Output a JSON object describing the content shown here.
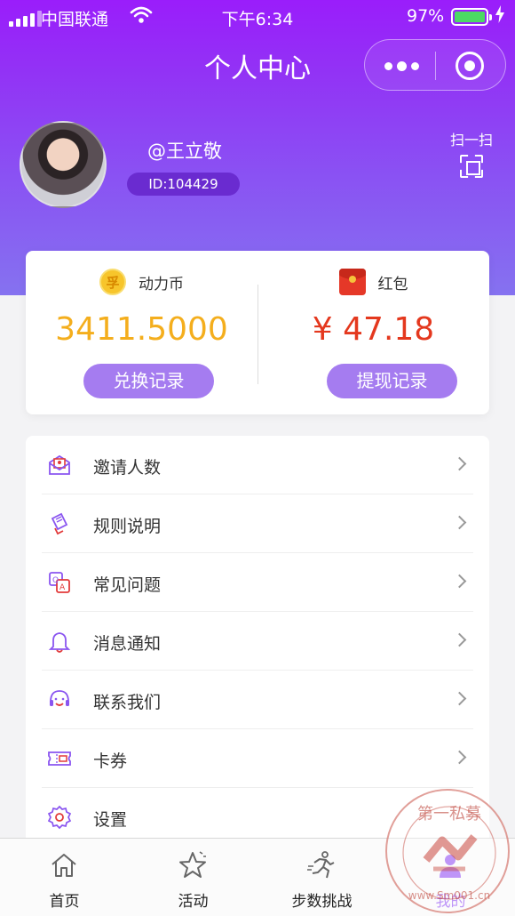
{
  "status_bar": {
    "carrier": "中国联通",
    "time": "下午6:34",
    "battery": "97%"
  },
  "nav": {
    "title": "个人中心"
  },
  "profile": {
    "name": "@王立敬",
    "id": "ID:104429",
    "scan_label": "扫一扫"
  },
  "wallet": {
    "coin": {
      "label": "动力币",
      "amount": "3411.5000",
      "button": "兑换记录",
      "icon_char": "孚"
    },
    "red_packet": {
      "label": "红包",
      "amount": "¥ 47.18",
      "button": "提现记录"
    }
  },
  "menu": [
    {
      "label": "邀请人数",
      "icon": "invite-envelope-icon"
    },
    {
      "label": "规则说明",
      "icon": "rules-scroll-icon"
    },
    {
      "label": "常见问题",
      "icon": "faq-translate-icon"
    },
    {
      "label": "消息通知",
      "icon": "bell-icon"
    },
    {
      "label": "联系我们",
      "icon": "headset-icon"
    },
    {
      "label": "卡券",
      "icon": "coupon-icon"
    },
    {
      "label": "设置",
      "icon": "gear-icon"
    }
  ],
  "tabs": [
    {
      "label": "首页",
      "icon": "home-icon"
    },
    {
      "label": "活动",
      "icon": "star-icon"
    },
    {
      "label": "步数挑战",
      "icon": "running-icon"
    },
    {
      "label": "我的",
      "icon": "profile-icon"
    }
  ],
  "watermark": {
    "text": "第一私募",
    "url": "www.Sm001.cn"
  },
  "colors": {
    "brand_purple": "#9a1dfb",
    "button_purple": "#a57cf0",
    "coin_orange": "#f4ae1d",
    "money_red": "#e4381e",
    "icon_purple": "#8a55f0"
  }
}
